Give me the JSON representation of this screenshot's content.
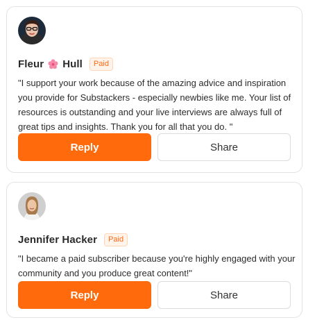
{
  "colors": {
    "accent": "#ff6a0d",
    "badge_text": "#ff6a13",
    "badge_bg": "#fff3ea"
  },
  "testimonials": [
    {
      "first_name": "Fleur",
      "name_emoji": "🌸",
      "last_name": "Hull",
      "badge": "Paid",
      "quote": "\"I support your work because of the amazing advice and inspiration you provide for Substackers - especially newbies like me. Your list of resources is outstanding and your live interviews are always full of great tips and insights. Thank you for all that you do. \"",
      "reply_label": "Reply",
      "share_label": "Share",
      "avatar_icon": "user-avatar-photo"
    },
    {
      "full_name": "Jennifer Hacker",
      "badge": "Paid",
      "quote": "\"I became a paid subscriber because you're highly engaged with your community and you produce great content!\"",
      "reply_label": "Reply",
      "share_label": "Share",
      "avatar_icon": "user-avatar-photo"
    }
  ]
}
